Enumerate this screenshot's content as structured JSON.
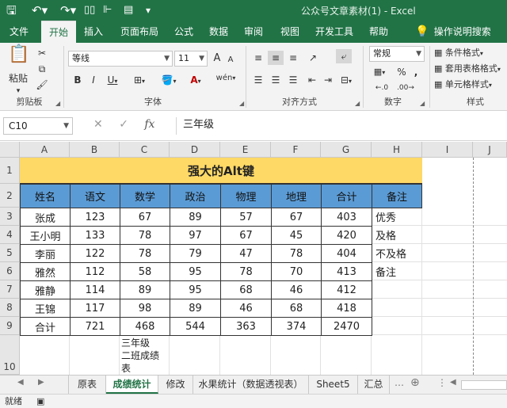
{
  "window": {
    "title": "公众号文章素材(1)  -  Excel"
  },
  "qat": {
    "save_icon": "save-icon",
    "undo_icon": "undo-icon"
  },
  "tabs": [
    {
      "label": "文件"
    },
    {
      "label": "开始"
    },
    {
      "label": "插入"
    },
    {
      "label": "页面布局"
    },
    {
      "label": "公式"
    },
    {
      "label": "数据"
    },
    {
      "label": "审阅"
    },
    {
      "label": "视图"
    },
    {
      "label": "开发工具"
    },
    {
      "label": "帮助"
    },
    {
      "label": "操作说明搜索"
    }
  ],
  "ribbon": {
    "clipboard": {
      "paste": "粘贴",
      "label": "剪贴板"
    },
    "font": {
      "name": "等线",
      "size": "11",
      "bold": "B",
      "italic": "I",
      "underline": "U",
      "grow": "A",
      "shrink": "A",
      "label": "字体"
    },
    "alignment": {
      "label": "对齐方式"
    },
    "number": {
      "format": "常规",
      "percent": "%",
      "comma": ",",
      "label": "数字"
    },
    "styles": {
      "conditional": "条件格式",
      "table": "套用表格格式",
      "cell": "单元格样式",
      "label": "样式"
    }
  },
  "formula_bar": {
    "name_box": "C10",
    "content": "三年级"
  },
  "columns": [
    "A",
    "B",
    "C",
    "D",
    "E",
    "F",
    "G",
    "H",
    "I",
    "J"
  ],
  "rows": [
    "1",
    "2",
    "3",
    "4",
    "5",
    "6",
    "7",
    "8",
    "9",
    "10"
  ],
  "sheet": {
    "title": "强大的Alt键",
    "headers": [
      "姓名",
      "语文",
      "数学",
      "政治",
      "物理",
      "地理",
      "合计",
      "备注"
    ],
    "data": [
      [
        "张成",
        "123",
        "67",
        "89",
        "57",
        "67",
        "403"
      ],
      [
        "王小明",
        "133",
        "78",
        "97",
        "67",
        "45",
        "420"
      ],
      [
        "李丽",
        "122",
        "78",
        "79",
        "47",
        "78",
        "404"
      ],
      [
        "雅然",
        "112",
        "58",
        "95",
        "78",
        "70",
        "413"
      ],
      [
        "雅静",
        "114",
        "89",
        "95",
        "68",
        "46",
        "412"
      ],
      [
        "王锦",
        "117",
        "98",
        "89",
        "46",
        "68",
        "418"
      ],
      [
        "合计",
        "721",
        "468",
        "544",
        "363",
        "374",
        "2470"
      ]
    ],
    "notes": [
      "优秀",
      "及格",
      "不及格",
      "备注"
    ],
    "c10_lines": [
      "三年级",
      "二班成绩",
      "表"
    ]
  },
  "sheet_tabs": [
    {
      "label": "原表"
    },
    {
      "label": "成绩统计"
    },
    {
      "label": "修改"
    },
    {
      "label": "水果统计（数据透视表）"
    },
    {
      "label": "Sheet5"
    },
    {
      "label": "汇总"
    }
  ],
  "status": {
    "ready": "就绪"
  }
}
